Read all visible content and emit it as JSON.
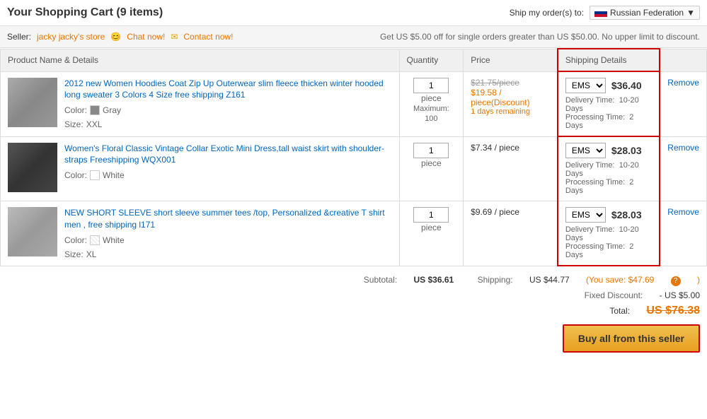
{
  "header": {
    "title": "Your Shopping Cart (9 items)",
    "ship_label": "Ship my order(s) to:",
    "country": "Russian Federation"
  },
  "seller": {
    "label": "Seller:",
    "name": "jacky jacky's store",
    "chat_label": "Chat now!",
    "contact_label": "Contact now!",
    "discount_notice": "Get US $5.00 off for single orders greater than US $50.00. No upper limit to discount."
  },
  "table": {
    "col_product": "Product Name & Details",
    "col_quantity": "Quantity",
    "col_price": "Price",
    "col_shipping": "Shipping Details"
  },
  "items": [
    {
      "name": "2012 new Women Hoodies Coat Zip Up Outerwear slim fleece thicken winter hooded long sweater 3 Colors 4 Size free shipping Z161",
      "color_label": "Color:",
      "color": "Gray",
      "size_label": "Size:",
      "size": "XXL",
      "qty": "1",
      "qty_unit": "piece",
      "qty_max": "Maximum: 100",
      "original_price": "$21.75/piece",
      "discount_price": "$19.58 / piece(Discount)",
      "remaining": "1 days remaining",
      "shipping_method": "EMS",
      "shipping_cost": "$36.40",
      "delivery_time": "10-20 Days",
      "processing_time": "2 Days"
    },
    {
      "name": "Women's Floral Classic Vintage Collar Exotic Mini Dress,tall waist skirt with shoulder-straps Freeshipping WQX001",
      "color_label": "Color:",
      "color": "White",
      "qty": "1",
      "qty_unit": "piece",
      "qty_max": "",
      "original_price": "",
      "discount_price": "",
      "regular_price": "$7.34 / piece",
      "remaining": "",
      "shipping_method": "EMS",
      "shipping_cost": "$28.03",
      "delivery_time": "10-20 Days",
      "processing_time": "2 Days"
    },
    {
      "name": "NEW SHORT SLEEVE short sleeve summer tees /top, Personalized &creative T shirt men , free shipping l171",
      "color_label": "Color:",
      "color": "White",
      "size_label": "Size:",
      "size": "XL",
      "qty": "1",
      "qty_unit": "piece",
      "qty_max": "",
      "original_price": "",
      "discount_price": "",
      "regular_price": "$9.69 / piece",
      "remaining": "",
      "shipping_method": "EMS",
      "shipping_cost": "$28.03",
      "delivery_time": "10-20 Days",
      "processing_time": "2 Days"
    }
  ],
  "summary": {
    "subtotal_label": "Subtotal:",
    "subtotal_value": "US $36.61",
    "shipping_label": "Shipping:",
    "shipping_value": "US $44.77",
    "save_label": "(You save: $47.69",
    "save_close": ")",
    "fixed_discount_label": "Fixed Discount:",
    "fixed_discount_value": "- US $5.00",
    "total_label": "Total:",
    "total_value": "US $76.38",
    "buy_button": "Buy all from this seller",
    "delivery_label": "Delivery Time:",
    "processing_label": "Processing Time:"
  }
}
